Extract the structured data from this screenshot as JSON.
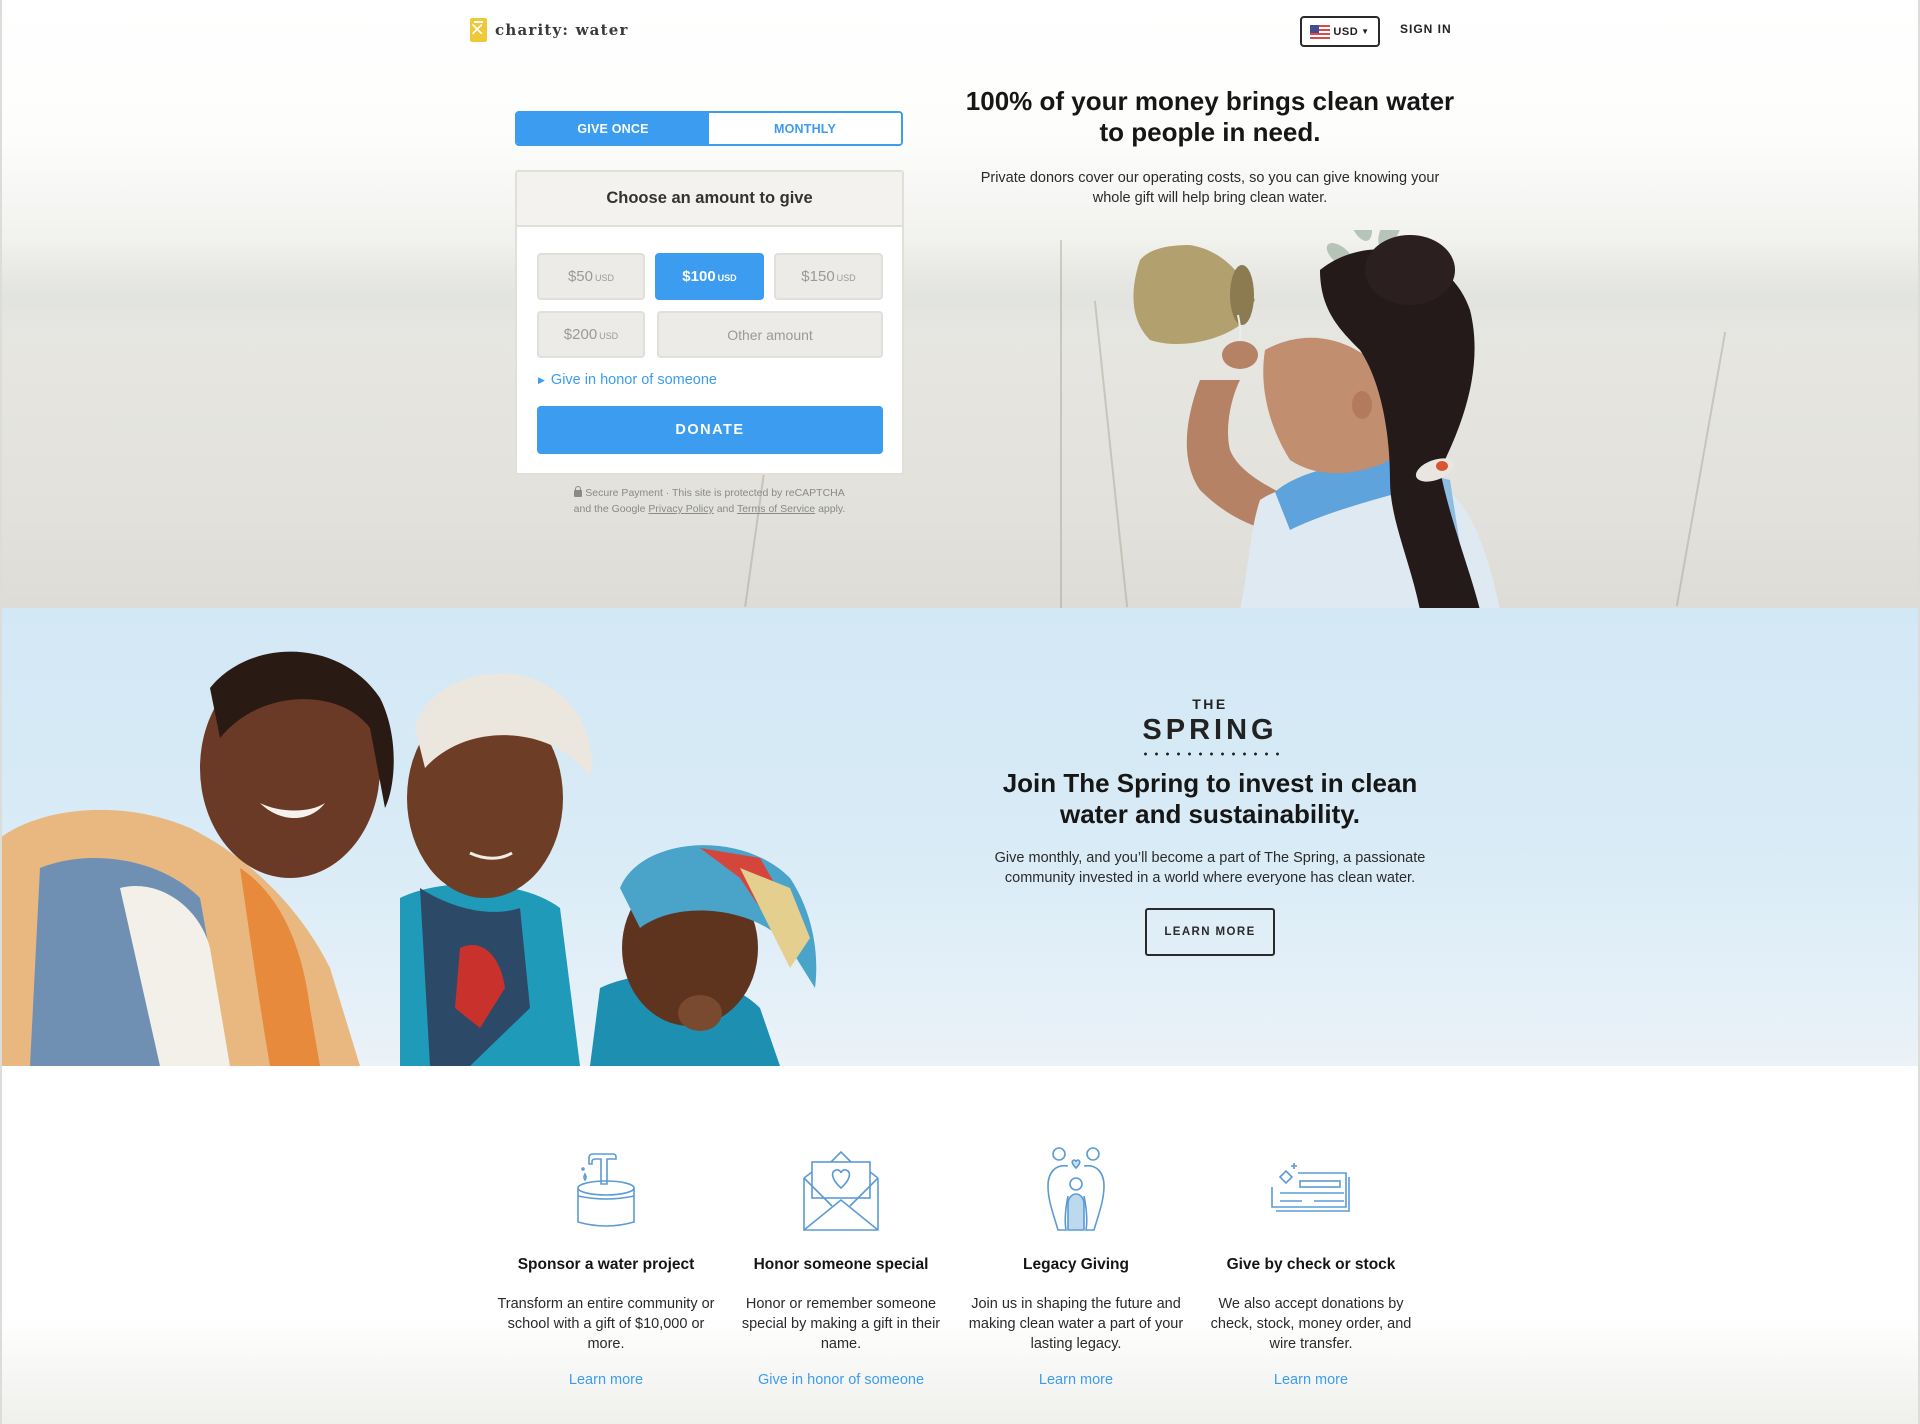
{
  "header": {
    "brand": "charity: water",
    "currency": "USD",
    "sign_in": "SIGN IN"
  },
  "donation_form": {
    "frequency_tabs": [
      {
        "label": "GIVE ONCE",
        "active": true
      },
      {
        "label": "MONTHLY",
        "active": false
      }
    ],
    "heading": "Choose an amount to give",
    "amounts": [
      {
        "value": "$50",
        "currency": "USD",
        "selected": false
      },
      {
        "value": "$100",
        "currency": "USD",
        "selected": true
      },
      {
        "value": "$150",
        "currency": "USD",
        "selected": false
      },
      {
        "value": "$200",
        "currency": "USD",
        "selected": false
      }
    ],
    "other_amount": "Other amount",
    "honor_link": "Give in honor of someone",
    "donate_label": "DONATE",
    "secure_line1": "Secure Payment · This site is protected by reCAPTCHA",
    "secure_and_the_google": "and the Google",
    "privacy_policy": "Privacy Policy",
    "and": "and",
    "terms_of_service": "Terms of Service",
    "apply": "apply."
  },
  "hero": {
    "title": "100% of your money brings clean water to people in need.",
    "subtitle": "Private donors cover our operating costs, so you can give knowing your whole gift will help bring clean water."
  },
  "spring": {
    "eyebrow": "THE",
    "name": "SPRING",
    "title": "Join The Spring to invest in clean water and sustainability.",
    "text": "Give monthly, and you’ll become a part of The Spring, a passionate community invested in a world where everyone has clean water.",
    "button": "LEARN MORE"
  },
  "features": [
    {
      "icon": "water-tap-icon",
      "title": "Sponsor a water project",
      "text": "Transform an entire community or school with a gift of $10,000 or more.",
      "link": "Learn more"
    },
    {
      "icon": "envelope-heart-icon",
      "title": "Honor someone special",
      "text": "Honor or remember someone special by making a gift in their name.",
      "link": "Give in honor of someone"
    },
    {
      "icon": "family-icon",
      "title": "Legacy Giving",
      "text": "Join us in shaping the future and making clean water a part of your lasting legacy.",
      "link": "Learn more"
    },
    {
      "icon": "check-icon",
      "title": "Give by check or stock",
      "text": "We also accept donations by check, stock, money order, and wire transfer.",
      "link": "Learn more"
    }
  ],
  "colors": {
    "accent": "#3b9cf0",
    "logo_yellow": "#f0c93a",
    "spring_bg": "#d8ebf6",
    "text_dark": "#161616"
  }
}
